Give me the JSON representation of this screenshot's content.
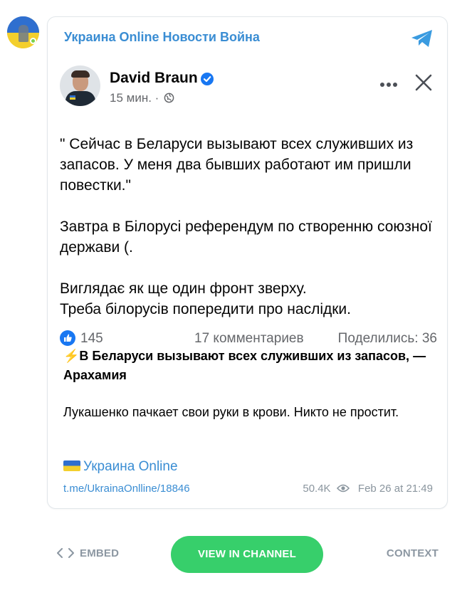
{
  "channel": {
    "name": "Украина Online Новости Война",
    "avatar_icon": "channel-avatar-icon",
    "telegram_icon": "telegram-plane-icon"
  },
  "fb_post": {
    "author": "David Braun",
    "time": "15 мин. ·",
    "verified_icon": "verified-badge-icon",
    "privacy_icon": "globe-icon",
    "more_icon": "more-dots-icon",
    "close_icon": "close-icon",
    "paragraphs": [
      "\" Сейчас в Беларуси вызывают всех служивших из запасов. У меня два бывших работают им пришли повестки.\"",
      "Завтра в Білорусі референдум по створенню союзної держави (.",
      "Виглядає як ще один фронт зверху.\nТреба білорусів попередити про наслідки."
    ],
    "likes": "145",
    "comments": "17 комментариев",
    "shares": "Поделились: 36"
  },
  "message": {
    "bolt": "⚡️",
    "headline": "В Беларуси вызывают всех служивших из запасов, — Арахамия",
    "body": "Лукашенко пачкает свои руки в крови. Никто не простит.",
    "source_label": "Украина Online",
    "link": "t.me/UkrainaOnlline/18846",
    "views": "50.4K",
    "date": "Feb 26 at 21:49"
  },
  "footer": {
    "embed_label": "EMBED",
    "view_label": "VIEW IN CHANNEL",
    "context_label": "CONTEXT"
  },
  "colors": {
    "accent": "#3a8dd3",
    "button": "#37cf6b",
    "muted": "#8c97a2",
    "fb_blue": "#1877f2"
  }
}
